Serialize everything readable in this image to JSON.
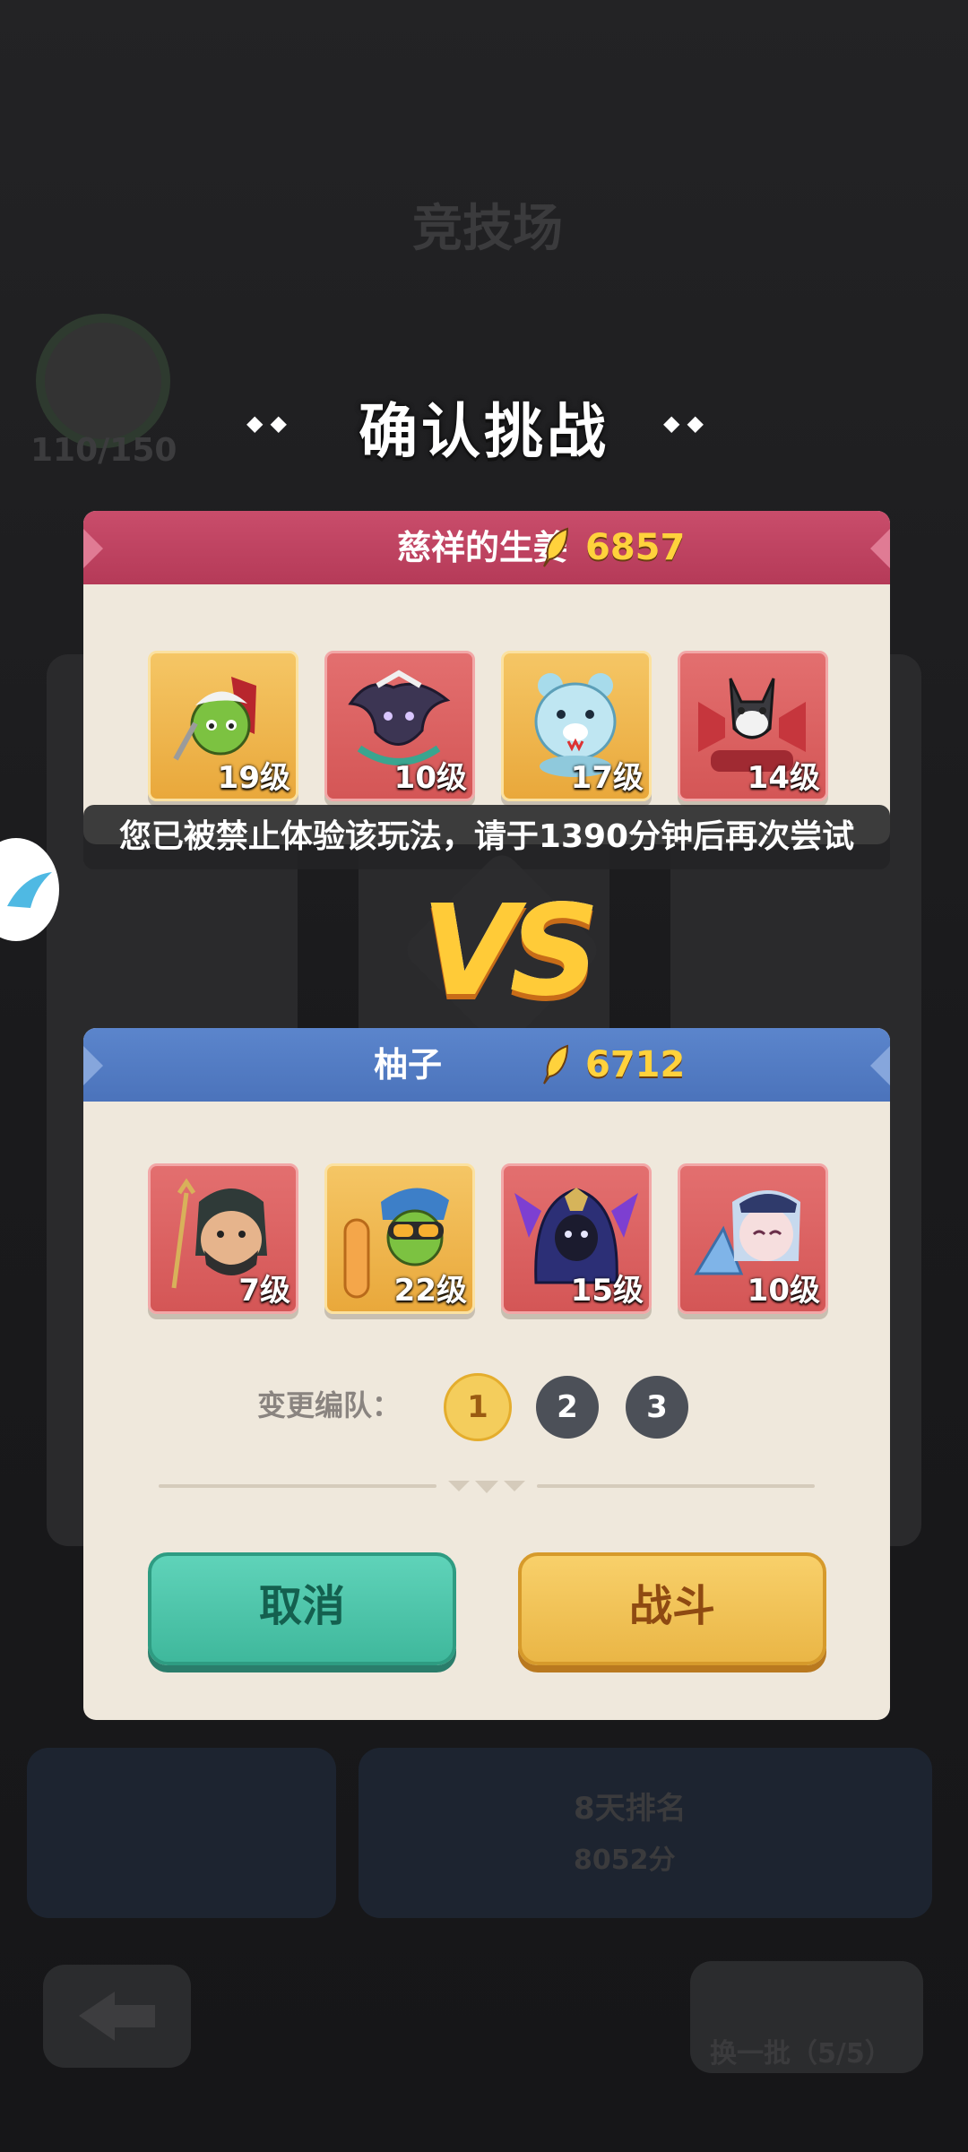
{
  "background": {
    "title": "竞技场",
    "counter": "110/150",
    "battle_button": "换一批（5/5）",
    "score_caption": "8天排名",
    "score_value": "8052分"
  },
  "dialog": {
    "title": "确认挑战",
    "opponent": {
      "name": "慈祥的生姜",
      "power": "6857",
      "heroes": [
        {
          "level": "19级",
          "frame": "gold",
          "icon": "goblin-warrior-icon"
        },
        {
          "level": "10级",
          "frame": "red",
          "icon": "dark-dragon-icon"
        },
        {
          "level": "17级",
          "frame": "gold",
          "icon": "ice-bear-icon"
        },
        {
          "level": "14级",
          "frame": "red",
          "icon": "wolf-mech-icon"
        }
      ]
    },
    "toast": "您已被禁止体验该玩法，请于1390分钟后再次尝试",
    "vs_label": "VS",
    "player": {
      "name": "柚子",
      "power": "6712",
      "heroes": [
        {
          "level": "7级",
          "frame": "red",
          "icon": "sea-king-icon"
        },
        {
          "level": "22级",
          "frame": "gold",
          "icon": "snowboard-goblin-icon"
        },
        {
          "level": "15级",
          "frame": "red",
          "icon": "hooded-mage-icon"
        },
        {
          "level": "10级",
          "frame": "red",
          "icon": "fan-girl-icon"
        }
      ]
    },
    "team_label": "变更编队：",
    "teams": [
      "1",
      "2",
      "3"
    ],
    "active_team": "1",
    "cancel_label": "取消",
    "fight_label": "战斗"
  },
  "colors": {
    "opponent_header": "#c2456a",
    "player_header": "#527bc4",
    "power": "#ffd23c",
    "cancel": "#4fc6ab",
    "fight": "#f1c255"
  }
}
